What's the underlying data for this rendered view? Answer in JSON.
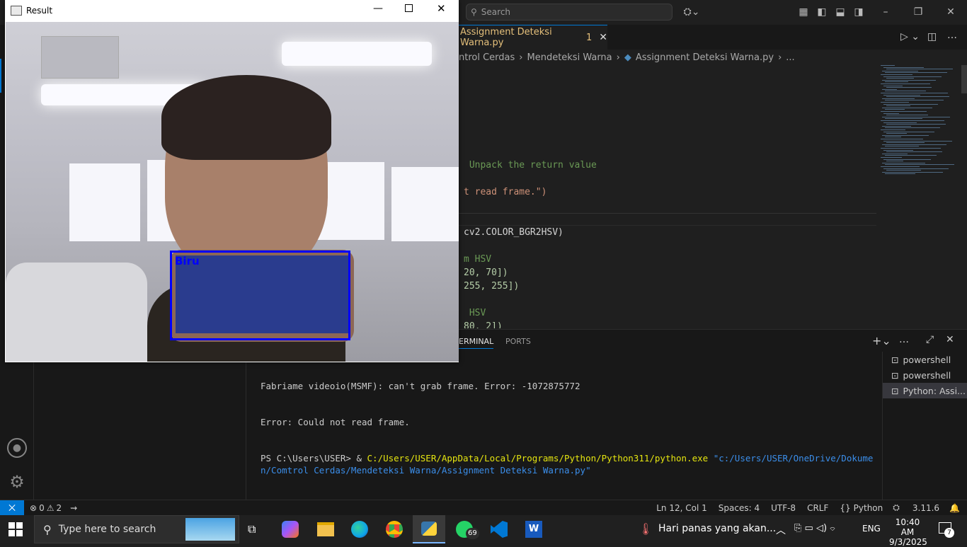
{
  "search": {
    "placeholder": "Search"
  },
  "editor": {
    "tab_title": "Assignment Deteksi Warna.py",
    "tab_badge": "1",
    "breadcrumbs": [
      "ntrol Cerdas",
      "Mendeteksi Warna",
      "Assignment Deteksi Warna.py",
      "..."
    ],
    "lines": [
      {
        "text": " Unpack the return value",
        "color": "#6a9955"
      },
      {
        "text": "t read frame.\")",
        "color": "#ce9178"
      },
      {
        "text": "cv2.COLOR_BGR2HSV)",
        "color": "#d4d4d4"
      },
      {
        "text": "m HSV",
        "color": "#6a9955"
      },
      {
        "text": "20, 70])",
        "color": "#b5cea8"
      },
      {
        "text": "255, 255])",
        "color": "#b5cea8"
      },
      {
        "text": " HSV",
        "color": "#6a9955"
      },
      {
        "text": "80, 2])",
        "color": "#b5cea8"
      }
    ]
  },
  "panel": {
    "tab_terminal": "ERMINAL",
    "tab_ports": "PORTS",
    "terminal_lines": [
      "Fabriame videoio(MSMF): can't grab frame. Error: -1072875772",
      "Error: Could not read frame."
    ],
    "prompt": "PS C:\\Users\\USER> & ",
    "python_path": "C:/Users/USER/AppData/Local/Programs/Python/Python311/python.exe",
    "script_path": "\"c:/Users/USER/OneDrive/Dokumen/Comtrol Cerdas/Mendeteksi Warna/Assignment Deteksi Warna.py\"",
    "terminals": [
      "powershell",
      "powershell",
      "Python: Assi..."
    ]
  },
  "status": {
    "errors": "0",
    "warnings": "2",
    "position": "Ln 12, Col 1",
    "spaces": "Spaces: 4",
    "encoding": "UTF-8",
    "eol": "CRLF",
    "language": "Python",
    "version": "3.11.6"
  },
  "result_window": {
    "title": "Result",
    "detected_label": "Biru"
  },
  "taskbar": {
    "search_placeholder": "Type here to search",
    "whatsapp_badge": "69",
    "weather_text": "Hari panas yang akan...",
    "language": "ENG",
    "time": "10:40 AM",
    "date": "9/3/2025",
    "notif_count": "7"
  },
  "colors": {
    "accent": "#0078d4",
    "detect_box": "#0000ff",
    "terminal_path": "#e5e510",
    "terminal_string": "#3b8eea"
  }
}
